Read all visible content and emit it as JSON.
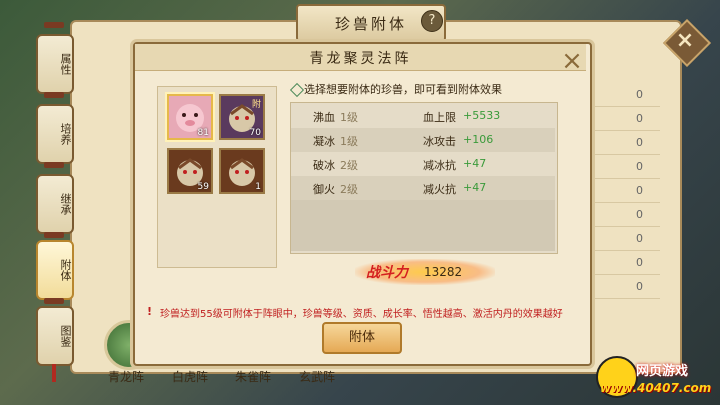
{
  "top_title": "珍兽附体",
  "help_icon": "?",
  "side_tabs": [
    {
      "label": "属性",
      "active": false
    },
    {
      "label": "培养",
      "active": false
    },
    {
      "label": "继承",
      "active": false
    },
    {
      "label": "附体",
      "active": true
    },
    {
      "label": "图鉴",
      "active": false
    }
  ],
  "bottom_tabs": [
    "青龙阵",
    "白虎阵",
    "朱雀阵",
    "玄武阵"
  ],
  "outer_close": "×",
  "outer_values": [
    "0",
    "0",
    "0",
    "0",
    "0",
    "0",
    "0",
    "0",
    "0"
  ],
  "modal": {
    "title": "青龙聚灵法阵",
    "close": "×",
    "instruction": "选择想要附体的珍兽，即可看到附体效果",
    "slots": [
      {
        "level": "81",
        "corner": "",
        "selected": true,
        "icon": "pig-beast-icon"
      },
      {
        "level": "70",
        "corner": "附",
        "selected": false,
        "icon": "tiger-beast-icon"
      },
      {
        "level": "59",
        "corner": "",
        "selected": false,
        "icon": "tiger-beast-icon"
      },
      {
        "level": "1",
        "corner": "",
        "selected": false,
        "icon": "tiger-beast-icon"
      }
    ],
    "skills": [
      {
        "name": "沸血",
        "level": "1级",
        "attr": "血上限",
        "value": "+5533"
      },
      {
        "name": "凝冰",
        "level": "1级",
        "attr": "冰攻击",
        "value": "+106"
      },
      {
        "name": "破冰",
        "level": "2级",
        "attr": "减冰抗",
        "value": "+47"
      },
      {
        "name": "御火",
        "level": "2级",
        "attr": "减火抗",
        "value": "+47"
      }
    ],
    "power_label": "战斗力",
    "power_value": "13282",
    "warning_icon": "!",
    "warning": "珍兽达到55级可附体于阵眼中，珍兽等级、资质、成长率、悟性越高、激活内丹的效果越好",
    "attach_button": "附体"
  },
  "watermark": {
    "name": "网页游戏",
    "url": "www.40407.com"
  },
  "colors": {
    "accent_gold": "#e5a955",
    "warning_red": "#c02020",
    "bonus_green": "#3a9a3a",
    "power_red": "#d42020"
  }
}
